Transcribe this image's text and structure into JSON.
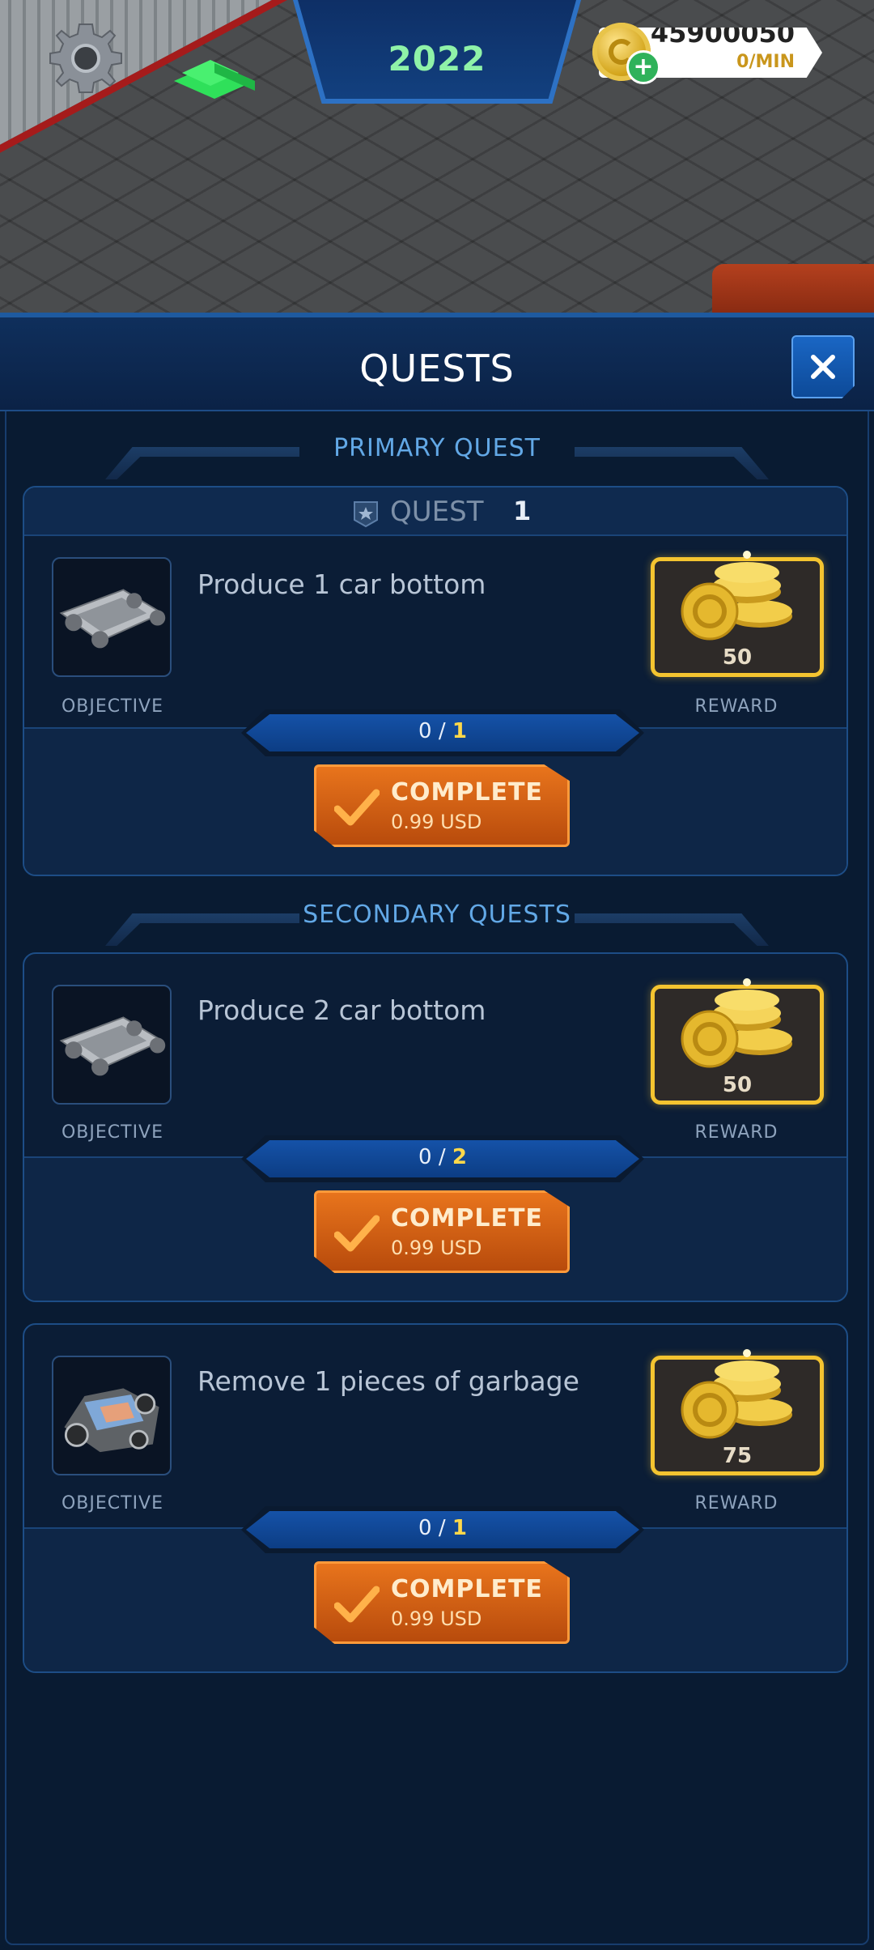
{
  "hud": {
    "year": "2022",
    "money_amount": "45900050",
    "money_rate": "0/MIN",
    "add_money_symbol": "+"
  },
  "panel": {
    "title": "QUESTS",
    "close_symbol": "×"
  },
  "primary": {
    "section_title": "PRIMARY QUEST",
    "quest_label": "QUEST",
    "quest_number": "1",
    "quest": {
      "objective_icon": "car-chassis-icon",
      "text": "Produce 1 car bottom",
      "objective_label": "OBJECTIVE",
      "reward_value": "50",
      "reward_label": "REWARD",
      "progress_current": "0",
      "progress_sep": " / ",
      "progress_total": "1",
      "complete_label": "COMPLETE",
      "complete_price": "0.99 USD"
    }
  },
  "secondary": {
    "section_title": "SECONDARY QUESTS",
    "quests": [
      {
        "objective_icon": "car-chassis-icon",
        "text": "Produce 2 car bottom",
        "objective_label": "OBJECTIVE",
        "reward_value": "50",
        "reward_label": "REWARD",
        "progress_current": "0",
        "progress_sep": " / ",
        "progress_total": "2",
        "complete_label": "COMPLETE",
        "complete_price": "0.99 USD"
      },
      {
        "objective_icon": "garbage-pile-icon",
        "text": "Remove 1 pieces of garbage",
        "objective_label": "OBJECTIVE",
        "reward_value": "75",
        "reward_label": "REWARD",
        "progress_current": "0",
        "progress_sep": " / ",
        "progress_total": "1",
        "complete_label": "COMPLETE",
        "complete_price": "0.99 USD"
      }
    ]
  },
  "colors": {
    "panel_bg": "#091b32",
    "accent_blue": "#62a8e6",
    "year_green": "#8ff2a8",
    "reward_gold": "#f4c430",
    "complete_orange": "#e8741c"
  }
}
